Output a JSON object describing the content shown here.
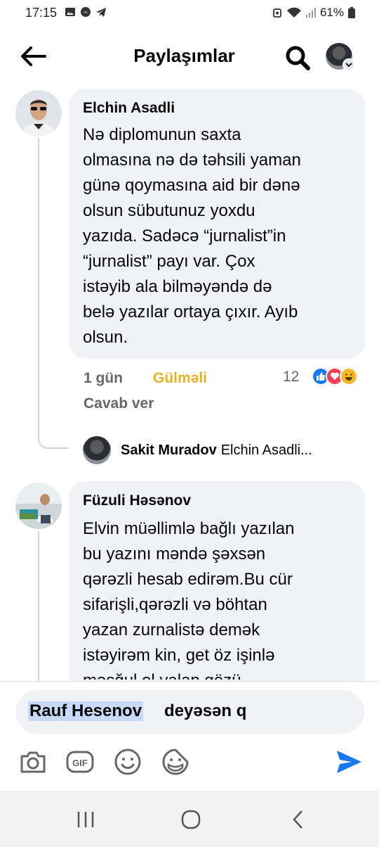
{
  "status_bar": {
    "time": "17:15",
    "battery": "61%"
  },
  "header": {
    "title": "Paylaşımlar"
  },
  "comments": [
    {
      "author": "Elchin Asadli",
      "text": "Nə diplomunun saxta\nolmasına nə də təhsili yaman\ngünə qoymasına aid bir dənə\nolsun sübutunuz yoxdu\nyazıda. Sadəcə “jurnalist”in\n“jurnalist” payı var. Çox\nistəyib ala bilməyəndə də\nbelə yazılar ortaya çıxır. Ayıb\nolsun.",
      "time": "1 gün",
      "reaction_label": "Gülməli",
      "reply_label": "Cavab ver",
      "reaction_count": "12",
      "reply": {
        "author": "Sakit Muradov",
        "preview": "Elchin Asadli..."
      }
    },
    {
      "author": "Füzuli Həsənov",
      "text": "Elvin müəllimlə bağlı yazılan\nbu yazını məndə şəxsən\nqərəzli hesab edirəm.Bu cür\nsifarişli,qərəzli və böhtan\nyazan zurnalistə demək\nistəyirəm kin, get öz işinlə\nməşğul ol,yalan gözü..."
    }
  ],
  "composer": {
    "mention": "Rauf Hesenov",
    "text": "deyəsən q"
  },
  "toolbar": {
    "icons": [
      "camera-icon",
      "gif-icon",
      "emoji-icon",
      "sticker-icon",
      "send-icon"
    ]
  },
  "colors": {
    "accent": "#1877f2",
    "reaction_haha": "#eab026",
    "bubble": "#f0f2f5"
  }
}
